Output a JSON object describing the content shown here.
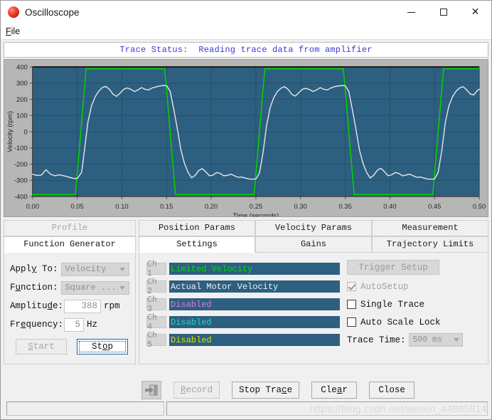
{
  "window": {
    "title": "Oscilloscope",
    "icon": "red-sphere-icon",
    "minimize": "─",
    "maximize": "□",
    "close": "✕"
  },
  "menubar": {
    "items": [
      {
        "label": "File",
        "mnemonic": "F"
      }
    ]
  },
  "trace_status": {
    "text": "Trace Status:  Reading trace data from amplifier",
    "color": "#3a3ad0"
  },
  "chart_data": {
    "type": "line",
    "title": "",
    "xlabel": "Time (seconds)",
    "ylabel": "Velocity (rpm)",
    "xlim": [
      0.0,
      0.5
    ],
    "ylim": [
      -400,
      400
    ],
    "xticks": [
      "0.00",
      "0.05",
      "0.10",
      "0.15",
      "0.20",
      "0.25",
      "0.30",
      "0.35",
      "0.40",
      "0.45",
      "0.50"
    ],
    "yticks": [
      "400",
      "300",
      "200",
      "100",
      "0",
      "-100",
      "-200",
      "-300",
      "-400"
    ],
    "grid": true,
    "plot_bg": "#2d5f80",
    "grid_color": "#24506e",
    "legend": "none",
    "series": [
      {
        "name": "Limited Velocity",
        "color": "#00d200",
        "description": "Commanded trapezoidal square wave, 5 Hz, amplitude 388 rpm",
        "points": [
          [
            0.0,
            -388
          ],
          [
            0.048,
            -388
          ],
          [
            0.06,
            388
          ],
          [
            0.148,
            388
          ],
          [
            0.16,
            -388
          ],
          [
            0.248,
            -388
          ],
          [
            0.26,
            388
          ],
          [
            0.348,
            388
          ],
          [
            0.36,
            -388
          ],
          [
            0.448,
            -388
          ],
          [
            0.46,
            388
          ],
          [
            0.5,
            388
          ]
        ]
      },
      {
        "name": "Actual Motor Velocity",
        "color": "#e8e8e8",
        "description": "Measured motor velocity response with overshoot and ripple",
        "points": [
          [
            0.0,
            -263
          ],
          [
            0.005,
            -270
          ],
          [
            0.01,
            -268
          ],
          [
            0.015,
            -235
          ],
          [
            0.02,
            -262
          ],
          [
            0.025,
            -272
          ],
          [
            0.03,
            -266
          ],
          [
            0.035,
            -272
          ],
          [
            0.04,
            -280
          ],
          [
            0.046,
            -288
          ],
          [
            0.05,
            -290
          ],
          [
            0.055,
            -250
          ],
          [
            0.058,
            -120
          ],
          [
            0.062,
            60
          ],
          [
            0.066,
            160
          ],
          [
            0.07,
            215
          ],
          [
            0.074,
            250
          ],
          [
            0.078,
            272
          ],
          [
            0.082,
            280
          ],
          [
            0.086,
            262
          ],
          [
            0.09,
            232
          ],
          [
            0.094,
            218
          ],
          [
            0.098,
            238
          ],
          [
            0.102,
            262
          ],
          [
            0.106,
            270
          ],
          [
            0.11,
            262
          ],
          [
            0.114,
            248
          ],
          [
            0.118,
            258
          ],
          [
            0.122,
            272
          ],
          [
            0.126,
            262
          ],
          [
            0.13,
            258
          ],
          [
            0.134,
            270
          ],
          [
            0.138,
            276
          ],
          [
            0.142,
            282
          ],
          [
            0.146,
            285
          ],
          [
            0.15,
            284
          ],
          [
            0.154,
            250
          ],
          [
            0.158,
            140
          ],
          [
            0.162,
            20
          ],
          [
            0.166,
            -110
          ],
          [
            0.17,
            -195
          ],
          [
            0.174,
            -250
          ],
          [
            0.178,
            -285
          ],
          [
            0.182,
            -270
          ],
          [
            0.186,
            -240
          ],
          [
            0.19,
            -228
          ],
          [
            0.194,
            -248
          ],
          [
            0.198,
            -272
          ],
          [
            0.202,
            -268
          ],
          [
            0.206,
            -252
          ],
          [
            0.21,
            -258
          ],
          [
            0.214,
            -272
          ],
          [
            0.218,
            -270
          ],
          [
            0.222,
            -262
          ],
          [
            0.226,
            -272
          ],
          [
            0.23,
            -282
          ],
          [
            0.234,
            -280
          ],
          [
            0.238,
            -286
          ],
          [
            0.242,
            -292
          ],
          [
            0.246,
            -293
          ],
          [
            0.25,
            -292
          ],
          [
            0.254,
            -255
          ],
          [
            0.258,
            -130
          ],
          [
            0.262,
            40
          ],
          [
            0.266,
            150
          ],
          [
            0.27,
            210
          ],
          [
            0.274,
            248
          ],
          [
            0.278,
            268
          ],
          [
            0.282,
            278
          ],
          [
            0.286,
            262
          ],
          [
            0.29,
            232
          ],
          [
            0.294,
            220
          ],
          [
            0.298,
            240
          ],
          [
            0.302,
            262
          ],
          [
            0.306,
            268
          ],
          [
            0.31,
            260
          ],
          [
            0.314,
            248
          ],
          [
            0.318,
            258
          ],
          [
            0.322,
            272
          ],
          [
            0.326,
            262
          ],
          [
            0.33,
            258
          ],
          [
            0.334,
            270
          ],
          [
            0.338,
            278
          ],
          [
            0.342,
            282
          ],
          [
            0.346,
            285
          ],
          [
            0.35,
            284
          ],
          [
            0.354,
            248
          ],
          [
            0.358,
            135
          ],
          [
            0.362,
            15
          ],
          [
            0.366,
            -115
          ],
          [
            0.37,
            -198
          ],
          [
            0.374,
            -252
          ],
          [
            0.378,
            -286
          ],
          [
            0.382,
            -268
          ],
          [
            0.386,
            -238
          ],
          [
            0.39,
            -226
          ],
          [
            0.394,
            -248
          ],
          [
            0.398,
            -272
          ],
          [
            0.402,
            -266
          ],
          [
            0.406,
            -252
          ],
          [
            0.41,
            -258
          ],
          [
            0.414,
            -272
          ],
          [
            0.418,
            -268
          ],
          [
            0.422,
            -262
          ],
          [
            0.426,
            -272
          ],
          [
            0.43,
            -282
          ],
          [
            0.434,
            -280
          ],
          [
            0.438,
            -286
          ],
          [
            0.442,
            -292
          ],
          [
            0.446,
            -293
          ],
          [
            0.45,
            -292
          ],
          [
            0.454,
            -250
          ],
          [
            0.458,
            -120
          ],
          [
            0.462,
            55
          ],
          [
            0.466,
            160
          ],
          [
            0.47,
            215
          ],
          [
            0.474,
            250
          ],
          [
            0.478,
            270
          ],
          [
            0.482,
            278
          ],
          [
            0.486,
            258
          ],
          [
            0.49,
            232
          ],
          [
            0.494,
            228
          ],
          [
            0.498,
            255
          ],
          [
            0.5,
            262
          ]
        ]
      }
    ]
  },
  "left_panel": {
    "tabs_top": [
      {
        "label": "Profile",
        "active": false,
        "disabled": true
      }
    ],
    "tabs_bottom": [
      {
        "label": "Function Generator",
        "active": true,
        "disabled": false
      }
    ],
    "fields": {
      "apply_to": {
        "label": "Apply To:",
        "mnemonic": "y",
        "value": "Velocity",
        "disabled": true
      },
      "function": {
        "label": "Function:",
        "mnemonic": "u",
        "value": "Square ...",
        "disabled": true
      },
      "amplitude": {
        "label": "Amplitude:",
        "mnemonic": "d",
        "value": "388",
        "unit": "rpm"
      },
      "frequency": {
        "label": "Frequency:",
        "mnemonic": "e",
        "value": "5",
        "unit": "Hz"
      }
    },
    "buttons": {
      "start": {
        "label": "Start",
        "mnemonic": "S",
        "disabled": true
      },
      "stop": {
        "label": "Stop",
        "mnemonic": "o",
        "focused": true
      }
    }
  },
  "right_panel": {
    "tabs_top": [
      {
        "label": "Position Params",
        "active": false
      },
      {
        "label": "Velocity Params",
        "active": false
      },
      {
        "label": "Measurement",
        "active": false
      }
    ],
    "tabs_bottom": [
      {
        "label": "Settings",
        "active": true
      },
      {
        "label": "Gains",
        "active": false
      },
      {
        "label": "Trajectory Limits",
        "active": false
      }
    ],
    "channels": [
      {
        "tag": "Ch 1",
        "value": "Limited Velocity",
        "color": "#00e000"
      },
      {
        "tag": "Ch 2",
        "value": "Actual Motor Velocity",
        "color": "#f2f2f2"
      },
      {
        "tag": "Ch 3",
        "value": "Disabled",
        "color": "#e07ae0"
      },
      {
        "tag": "Ch 4",
        "value": "Disabled",
        "color": "#28d2d2"
      },
      {
        "tag": "Ch 5",
        "value": "Disabled",
        "color": "#e0e000"
      }
    ],
    "options": {
      "trigger_setup": {
        "label": "Trigger Setup",
        "disabled": true
      },
      "autosetup": {
        "label": "AutoSetup",
        "checked": true,
        "disabled": true
      },
      "single_trace": {
        "label": "Single Trace",
        "checked": false,
        "disabled": false
      },
      "auto_scale_lock": {
        "label": "Auto Scale Lock",
        "checked": false,
        "disabled": false
      },
      "trace_time": {
        "label": "Trace Time:",
        "value": "500 ms",
        "disabled": true
      }
    }
  },
  "actionbar": {
    "export": {
      "icon": "export-icon"
    },
    "buttons": [
      {
        "label": "Record",
        "mnemonic": "R",
        "disabled": true
      },
      {
        "label": "Stop Trace",
        "mnemonic": "c",
        "disabled": false
      },
      {
        "label": "Clear",
        "mnemonic": "a",
        "disabled": false
      },
      {
        "label": "Close",
        "mnemonic": "",
        "disabled": false
      }
    ]
  },
  "statusbar": {
    "left": "",
    "right": "",
    "watermark": "https://blog.csdn.net/weixin_44965814"
  }
}
